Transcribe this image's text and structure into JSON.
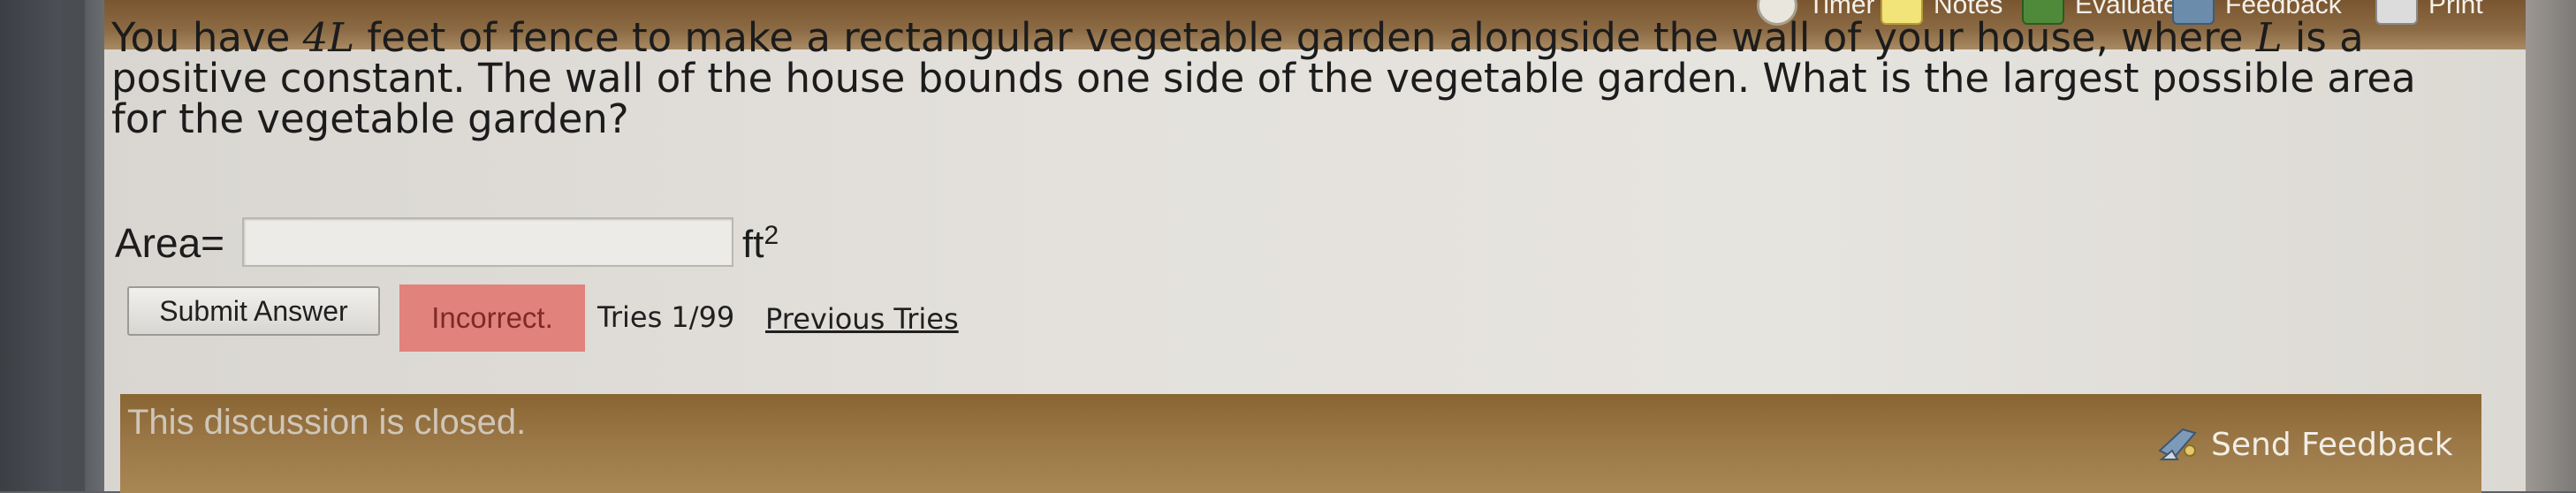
{
  "toolbar": {
    "items": [
      {
        "label": "Timer",
        "icon": "timer-icon"
      },
      {
        "label": "Notes",
        "icon": "notes-icon"
      },
      {
        "label": "Evaluate",
        "icon": "evaluate-icon"
      },
      {
        "label": "Feedback",
        "icon": "feedback-icon"
      },
      {
        "label": "Print",
        "icon": "print-icon"
      }
    ]
  },
  "question": {
    "part1": "You have ",
    "math1": "4L",
    "part2": " feet of fence to make a rectangular vegetable garden alongside the wall of your house, where ",
    "math2": "L",
    "part3": " is a positive constant. The wall of the house bounds one side of the vegetable garden. What is the largest possible area for the vegetable garden?"
  },
  "answer": {
    "label": "Area=",
    "value": "",
    "unit": "ft",
    "unit_exponent": "2"
  },
  "submission": {
    "submit_label": "Submit Answer",
    "status": "Incorrect.",
    "tries": "Tries 1/99",
    "previous_tries": "Previous Tries"
  },
  "discussion": {
    "closed_text": "This discussion is closed.",
    "send_feedback": "Send Feedback"
  },
  "colors": {
    "header_brown": "#8b6a44",
    "incorrect_bg": "#e2827c",
    "discussion_bar": "#9b7847"
  }
}
